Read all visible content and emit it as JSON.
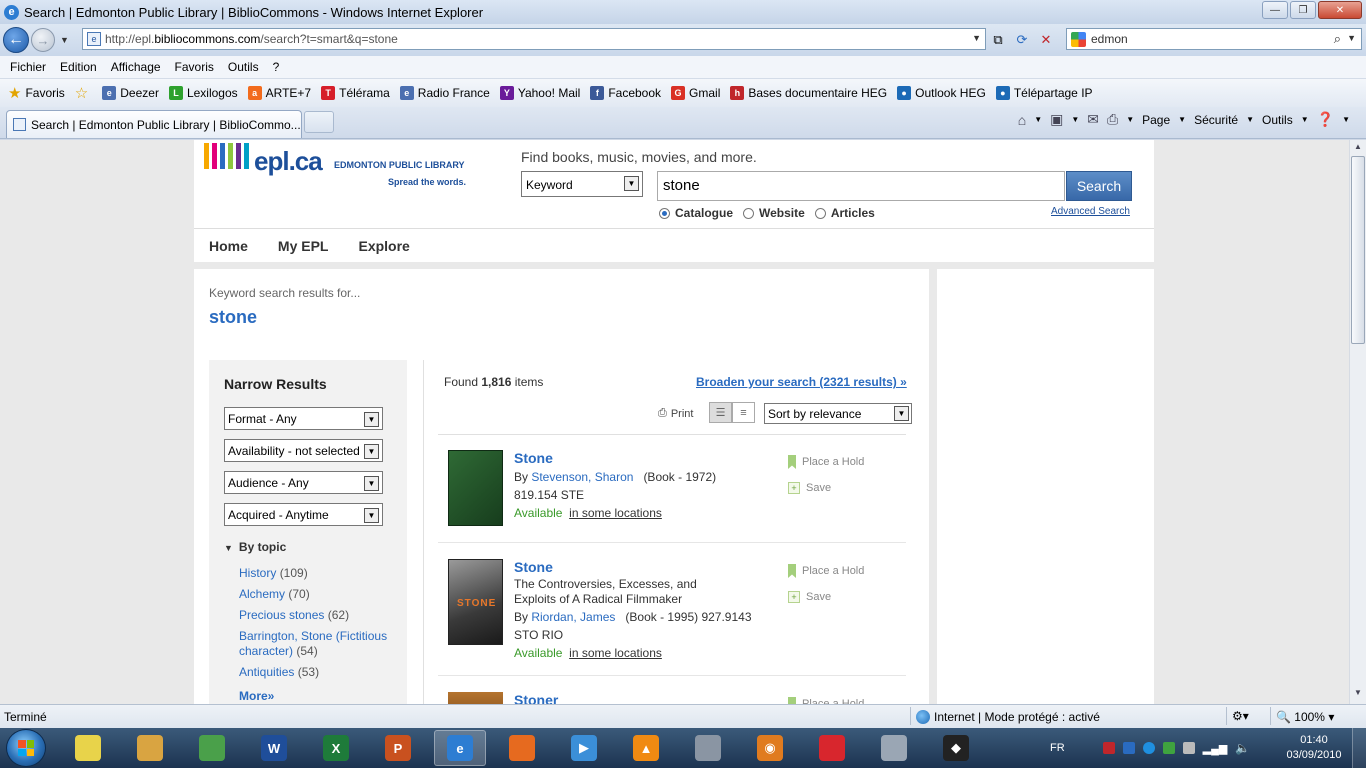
{
  "window": {
    "title": "Search | Edmonton Public Library | BiblioCommons - Windows Internet Explorer",
    "min": "—",
    "max": "❐",
    "close": "✕"
  },
  "address": {
    "url_prefix": "http://epl.",
    "url_domain": "bibliocommons.com",
    "url_rest": "/search?t=smart&q=stone",
    "search_value": "edmon"
  },
  "menu": [
    "Fichier",
    "Edition",
    "Affichage",
    "Favoris",
    "Outils",
    "?"
  ],
  "favorites": {
    "label": "Favoris",
    "items": [
      {
        "label": "Deezer",
        "color": "#4b6fb0",
        "glyph": "e"
      },
      {
        "label": "Lexilogos",
        "color": "#2ea12e",
        "glyph": "L"
      },
      {
        "label": "ARTE+7",
        "color": "#f26b1d",
        "glyph": "a"
      },
      {
        "label": "Télérama",
        "color": "#d61e2a",
        "glyph": "T"
      },
      {
        "label": "Radio France",
        "color": "#4b6fb0",
        "glyph": "e"
      },
      {
        "label": "Yahoo! Mail",
        "color": "#6a1b9a",
        "glyph": "Y"
      },
      {
        "label": "Facebook",
        "color": "#3b5998",
        "glyph": "f"
      },
      {
        "label": "Gmail",
        "color": "#d93025",
        "glyph": "G"
      },
      {
        "label": "Bases documentaire HEG",
        "color": "#c0262b",
        "glyph": "h"
      },
      {
        "label": "Outlook HEG",
        "color": "#1c6ab6",
        "glyph": "●"
      },
      {
        "label": "Télépartage IP",
        "color": "#1c6ab6",
        "glyph": "●"
      }
    ]
  },
  "tab": {
    "label": "Search | Edmonton Public Library | BiblioCommo...",
    "commands": [
      "Page",
      "Sécurité",
      "Outils"
    ]
  },
  "header": {
    "logo_text": "epl.ca",
    "logo_sub": "EDMONTON PUBLIC LIBRARY",
    "logo_tag": "Spread the words.",
    "logo_bar_colors": [
      "#f7a800",
      "#e2007a",
      "#2a6bc0",
      "#8dc63f",
      "#6a2c91",
      "#00a0c6"
    ],
    "find_label": "Find books, music, movies, and more.",
    "search_type": "Keyword",
    "query": "stone",
    "search_button": "Search",
    "scopes": [
      "Catalogue",
      "Website",
      "Articles"
    ],
    "scope_selected": "Catalogue",
    "advanced": "Advanced Search"
  },
  "nav": [
    "Home",
    "My EPL",
    "Explore"
  ],
  "results_header": {
    "label": "Keyword search results for...",
    "term": "stone"
  },
  "narrow": {
    "title": "Narrow Results",
    "filters": [
      "Format - Any",
      "Availability - not selected",
      "Audience - Any",
      "Acquired - Anytime"
    ],
    "by_topic": "By topic",
    "topics": [
      {
        "label": "History",
        "count": "(109)"
      },
      {
        "label": "Alchemy",
        "count": "(70)"
      },
      {
        "label": "Precious stones",
        "count": "(62)"
      },
      {
        "label": "Barrington, Stone (Fictitious character)",
        "count": "(54)"
      },
      {
        "label": "Antiquities",
        "count": "(53)"
      }
    ],
    "more": "More»"
  },
  "results": {
    "found_prefix": "Found ",
    "found_count": "1,816",
    "found_suffix": " items",
    "broaden": "Broaden your search (2321 results) »",
    "print": "Print",
    "sort": "Sort by relevance",
    "hold_label": "Place a Hold",
    "save_label": "Save",
    "items": [
      {
        "title": "Stone",
        "by": "By ",
        "author": "Stevenson, Sharon",
        "meta": "(Book - 1972)",
        "call": "819.154 STE",
        "avail": "Available",
        "loc": "in some locations"
      },
      {
        "title": "Stone",
        "subtitle1": "The Controversies, Excesses, and",
        "subtitle2": "Exploits of A Radical Filmmaker",
        "by": "By ",
        "author": "Riordan, James",
        "meta": "(Book - 1995) 927.9143",
        "call": "STO RIO",
        "avail": "Available",
        "loc": "in some locations"
      },
      {
        "title": "Stoner"
      }
    ]
  },
  "status": {
    "text": "Terminé",
    "zone": "Internet | Mode protégé : activé",
    "zoom": "100%"
  },
  "taskbar": {
    "lang": "FR",
    "time": "01:40",
    "date": "03/09/2010",
    "apps": [
      {
        "name": "sticky-notes",
        "color": "#e8d34a",
        "glyph": ""
      },
      {
        "name": "explorer",
        "color": "#d9a441",
        "glyph": ""
      },
      {
        "name": "chrome-globe",
        "color": "#4aa04a",
        "glyph": ""
      },
      {
        "name": "word",
        "color": "#1f4e9a",
        "glyph": "W"
      },
      {
        "name": "excel",
        "color": "#1e7b3a",
        "glyph": "X"
      },
      {
        "name": "powerpoint",
        "color": "#c9511f",
        "glyph": "P"
      },
      {
        "name": "internet-explorer",
        "color": "#2d7dd2",
        "glyph": "e"
      },
      {
        "name": "firefox",
        "color": "#e66a1f",
        "glyph": ""
      },
      {
        "name": "media-player",
        "color": "#3b8fd8",
        "glyph": "▶"
      },
      {
        "name": "vlc",
        "color": "#f08a12",
        "glyph": "▲"
      },
      {
        "name": "tool",
        "color": "#8a95a3",
        "glyph": ""
      },
      {
        "name": "eye-app",
        "color": "#e07b1f",
        "glyph": "◉"
      },
      {
        "name": "paint",
        "color": "#d8262d",
        "glyph": ""
      },
      {
        "name": "calculator",
        "color": "#9aa6b4",
        "glyph": ""
      },
      {
        "name": "app-dark",
        "color": "#222222",
        "glyph": "◆"
      }
    ]
  }
}
